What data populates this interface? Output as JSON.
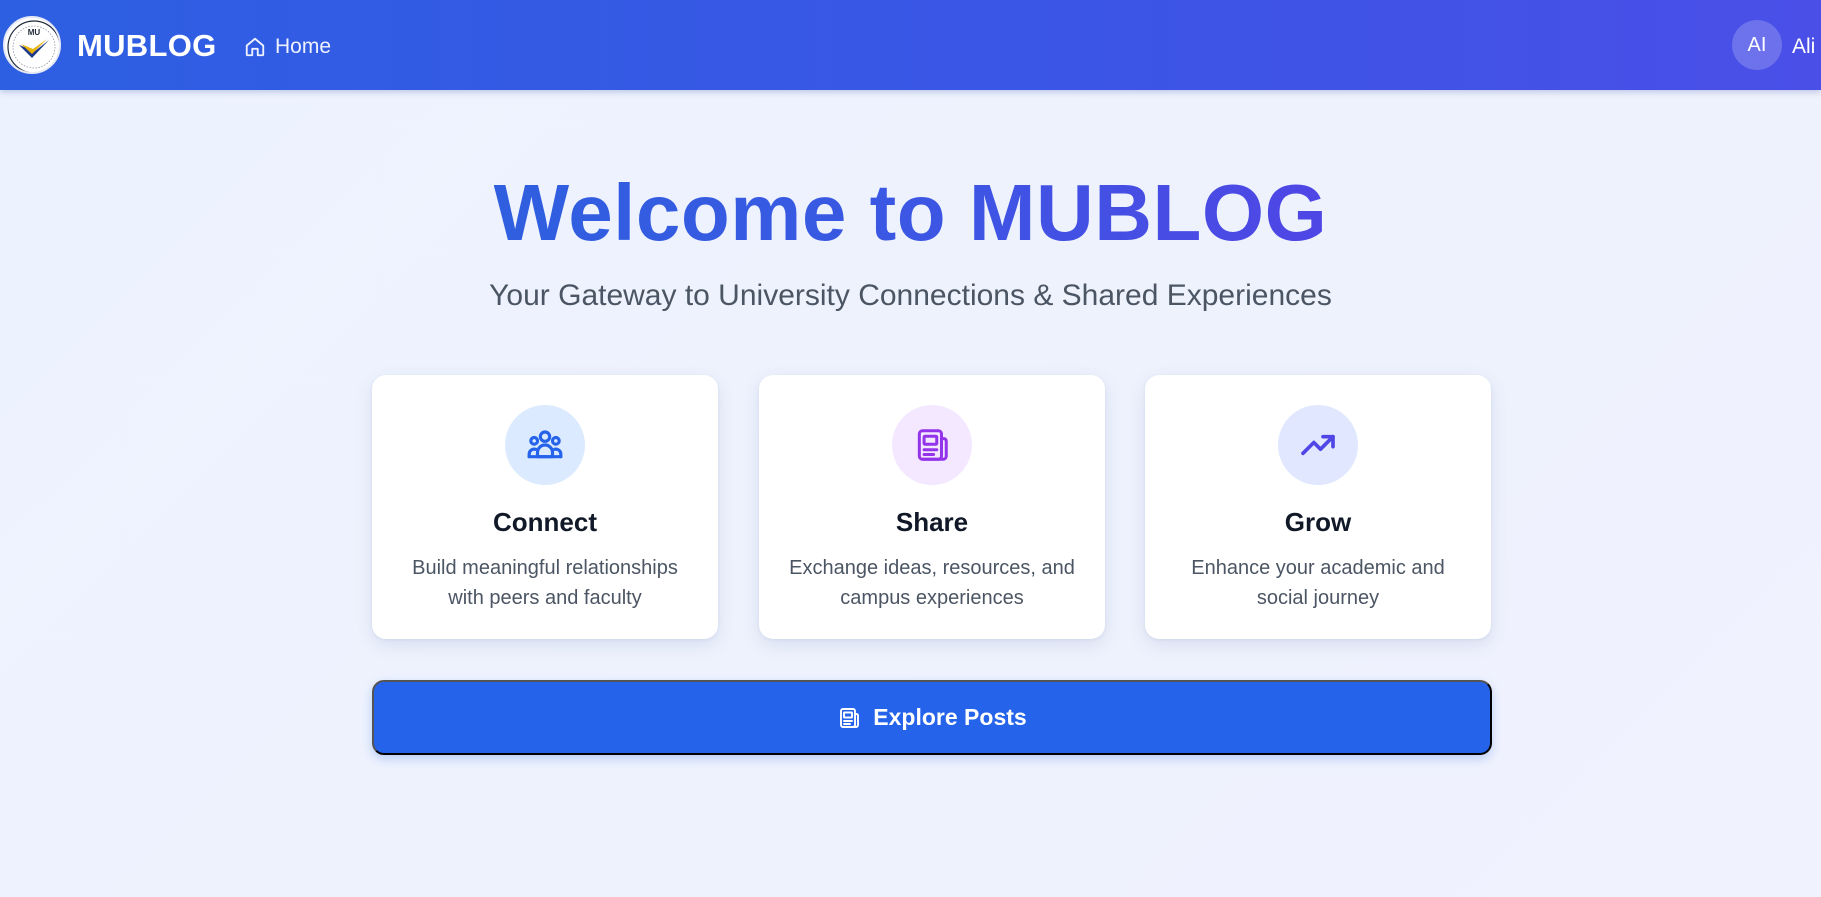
{
  "navbar": {
    "brand": "MUBLOG",
    "logo_text": "MU",
    "home_label": "Home",
    "avatar_initials": "AI",
    "user_name": "Ali"
  },
  "hero": {
    "title": "Welcome to MUBLOG",
    "subtitle": "Your Gateway to University Connections & Shared Experiences"
  },
  "cards": [
    {
      "icon": "users-icon",
      "title": "Connect",
      "description": "Build meaningful relationships with peers and faculty",
      "icon_bg": "#dbeafe",
      "icon_color": "#2563eb"
    },
    {
      "icon": "newspaper-icon",
      "title": "Share",
      "description": "Exchange ideas, resources, and campus experiences",
      "icon_bg": "#f3e8ff",
      "icon_color": "#9333ea"
    },
    {
      "icon": "trending-up-icon",
      "title": "Grow",
      "description": "Enhance your academic and social journey",
      "icon_bg": "#e0e7ff",
      "icon_color": "#4f46e5"
    }
  ],
  "cta": {
    "label": "Explore Posts",
    "icon": "newspaper-icon",
    "color": "#2563eb"
  },
  "colors": {
    "navbar_start": "#2d5fe2",
    "navbar_end": "#4a4fe8",
    "background": "#eef3fe"
  }
}
